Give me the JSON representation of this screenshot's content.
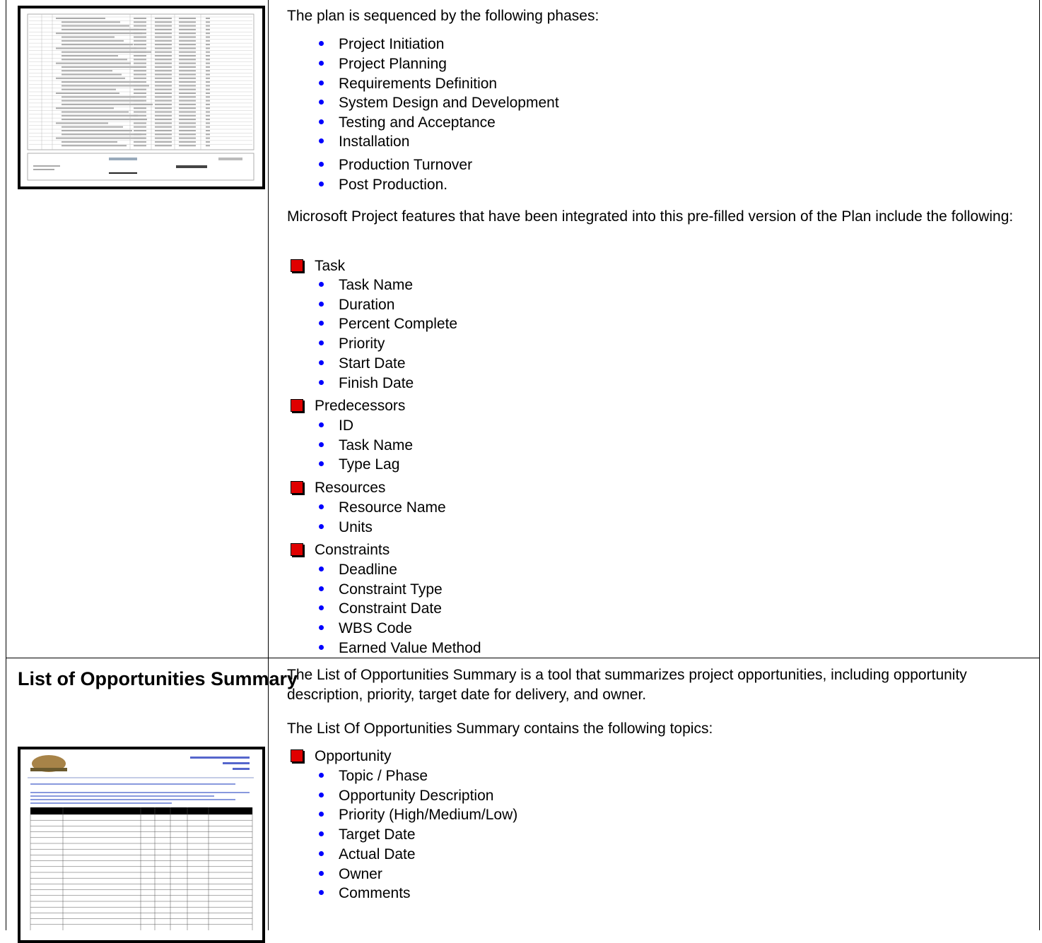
{
  "phases_intro": "The plan is sequenced by the following phases:",
  "phases": [
    "Project Initiation",
    "Project Planning",
    "Requirements Definition",
    "System Design and Development",
    "Testing and Acceptance",
    "Installation",
    "Production Turnover",
    "Post Production."
  ],
  "features_intro": "Microsoft Project features that have been integrated into this pre-filled version of the Plan include the following:",
  "features": [
    {
      "category": "Task",
      "items": [
        "Task Name",
        "Duration",
        "Percent Complete",
        "Priority",
        "Start Date",
        "Finish Date"
      ]
    },
    {
      "category": "Predecessors",
      "items": [
        "ID",
        "Task Name",
        "Type Lag"
      ]
    },
    {
      "category": "Resources",
      "items": [
        "Resource Name",
        "Units"
      ]
    },
    {
      "category": "Constraints",
      "items": [
        "Deadline",
        "Constraint Type",
        "Constraint Date",
        "WBS Code",
        "Earned Value Method"
      ]
    }
  ],
  "opportunities": {
    "heading": "List of Opportunities Summary",
    "description": "The List of Opportunities Summary is a tool that summarizes project opportunities, including opportunity description, priority, target date for delivery, and owner.",
    "topics_intro": "The List Of Opportunities Summary  contains the following topics:",
    "topic_category": "Opportunity",
    "topics": [
      "Topic / Phase",
      "Opportunity Description",
      "Priority (High/Medium/Low)",
      "Target Date",
      "Actual Date",
      "Owner",
      "Comments"
    ]
  },
  "colors": {
    "bullet": "#0000ff",
    "square_bullet": "#e00000"
  }
}
